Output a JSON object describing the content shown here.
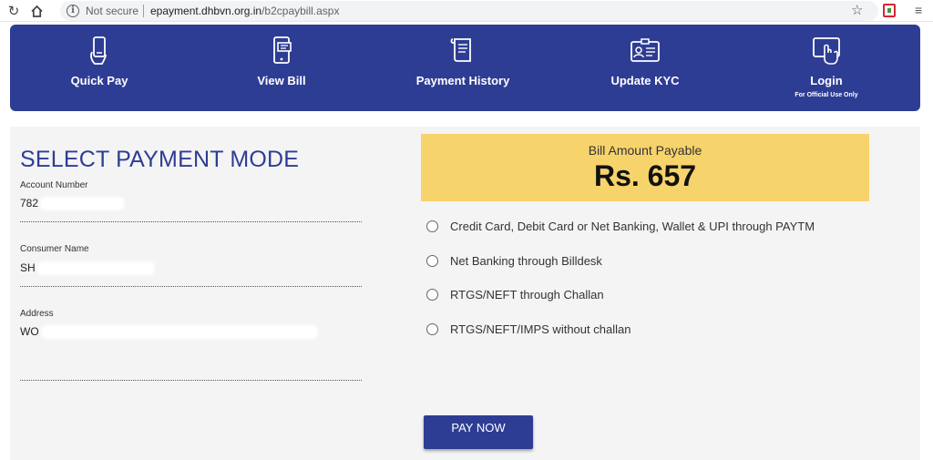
{
  "browser": {
    "security_label": "Not secure",
    "url_host": "epayment.dhbvn.org.in",
    "url_path": "/b2cpaybill.aspx"
  },
  "nav": {
    "items": [
      {
        "label": "Quick Pay",
        "icon": "phone-hand-icon"
      },
      {
        "label": "View Bill",
        "icon": "bill-screen-icon"
      },
      {
        "label": "Payment History",
        "icon": "scroll-document-icon"
      },
      {
        "label": "Update KYC",
        "icon": "id-card-icon"
      },
      {
        "label": "Login",
        "sub": "For Official Use Only",
        "icon": "touch-login-icon"
      }
    ]
  },
  "form": {
    "title": "SELECT PAYMENT MODE",
    "account_number_label": "Account Number",
    "account_number_value": "782",
    "consumer_name_label": "Consumer Name",
    "consumer_name_value": "SH",
    "address_label": "Address",
    "address_value": "WO"
  },
  "bill": {
    "label": "Bill Amount Payable",
    "amount": "Rs. 657"
  },
  "payment_options": [
    "Credit Card, Debit Card or Net Banking, Wallet & UPI through PAYTM",
    "Net Banking through Billdesk",
    "RTGS/NEFT through Challan",
    "RTGS/NEFT/IMPS without challan"
  ],
  "pay_button": "PAY NOW",
  "colors": {
    "brand_blue": "#2e3d94",
    "bill_yellow": "#f7d36c",
    "panel_gray": "#f4f4f4"
  }
}
